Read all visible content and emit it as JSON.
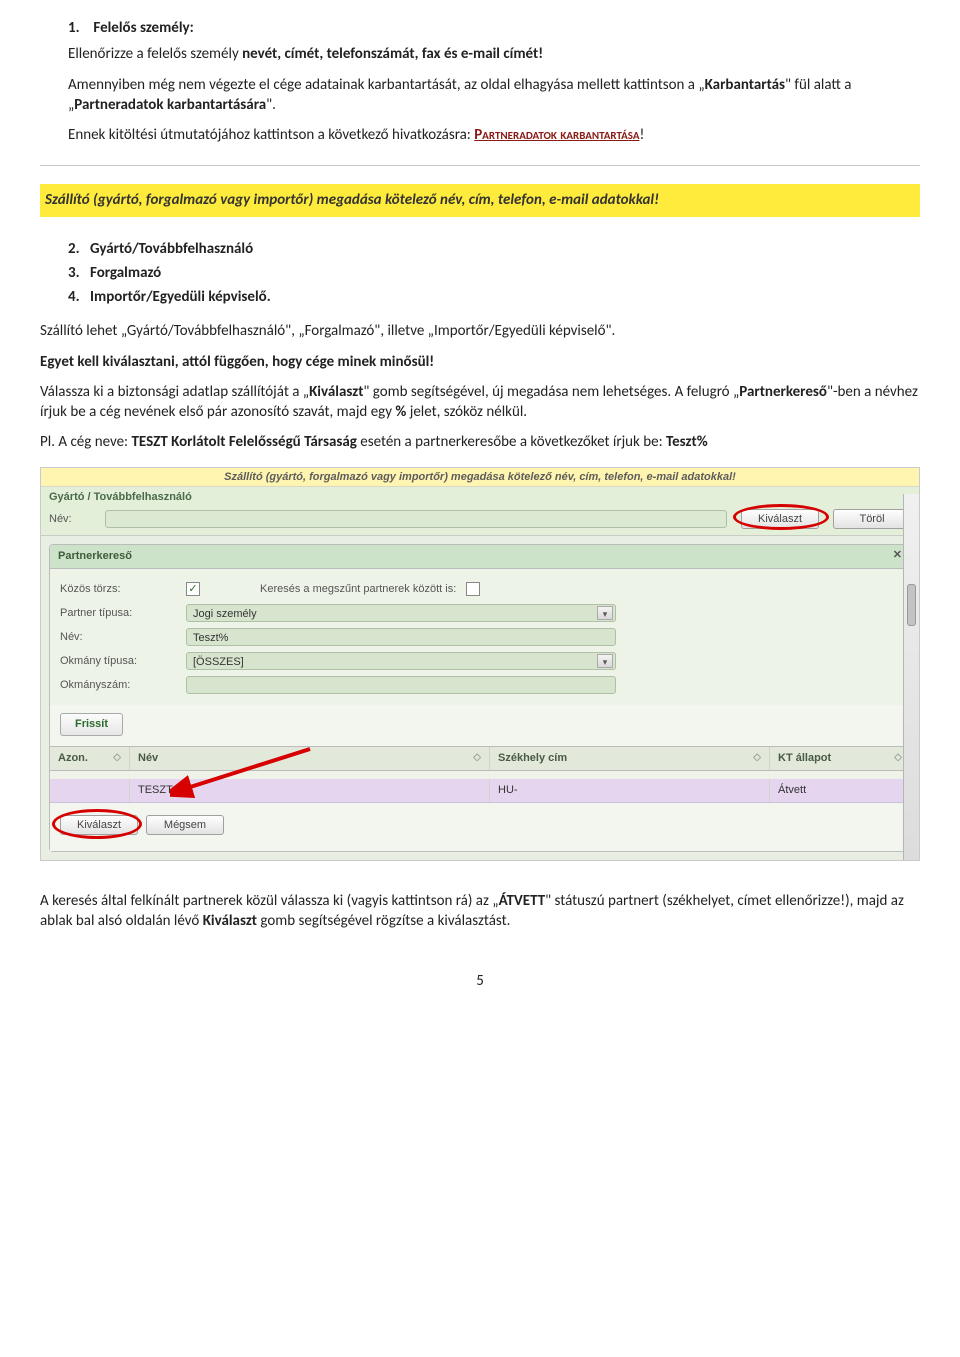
{
  "section1": {
    "num": "1.",
    "title": "Felelős személy:",
    "p1_a": "Ellenőrizze a felelős személy ",
    "p1_b": "nevét, címét, telefonszámát, fax és e-mail címét!",
    "p2_a": "Amennyiben még nem végezte el cége adatainak karbantartását, az oldal elhagyása mellett kattintson a „",
    "p2_b": "Karbantartás",
    "p2_c": "\" fül alatt a „",
    "p2_d": "Partneradatok karbantartására",
    "p2_e": "\".",
    "p3_a": "Ennek kitöltési útmutatójához kattintson a következő hivatkozásra: ",
    "link": "Partneradatok karbantartása",
    "p3_b": "!"
  },
  "yellow_msg": "Szállító (gyártó, forgalmazó vagy importőr) megadása kötelező név, cím, telefon, e-mail adatokkal!",
  "list2": {
    "i2n": "2.",
    "i2": "Gyártó/Továbbfelhasználó",
    "i3n": "3.",
    "i3": "Forgalmazó",
    "i4n": "4.",
    "i4": "Importőr/Egyedüli képviselő."
  },
  "body": {
    "p4": "Szállító lehet „Gyártó/Továbbfelhasználó\", „Forgalmazó\", illetve „Importőr/Egyedüli képviselő\".",
    "p5": "Egyet kell kiválasztani, attól függően, hogy cége minek minősül!",
    "p6_a": "Válassza ki a biztonsági adatlap szállítóját a „",
    "p6_b": "Kiválaszt",
    "p6_c": "\" gomb segítségével, új megadása nem lehetséges. A felugró „",
    "p6_d": "Partnerkereső",
    "p6_e": "\"-ben a névhez írjuk be a cég nevének első pár azonosító szavát, majd egy ",
    "p6_f": "%",
    "p6_g": " jelet, szóköz nélkül.",
    "p7_a": "Pl. A cég neve: ",
    "p7_b": "TESZT Korlátolt Felelősségű Társaság",
    "p7_c": " esetén a partnerkeresőbe a következőket írjuk be: ",
    "p7_d": "Teszt%"
  },
  "app": {
    "top_yellow": "Szállító (gyártó, forgalmazó vagy importőr) megadása kötelező név, cím, telefon, e-mail adatokkal!",
    "gy_label": "Gyártó / Továbbfelhasználó",
    "nev_label": "Név:",
    "btn_kivalaszt": "Kiválaszt",
    "btn_torol": "Töröl",
    "panel_title": "Partnerkereső",
    "close": "✕",
    "f1_label": "Közös törzs:",
    "f1_chk": "✓",
    "f1_right": "Keresés a megszűnt partnerek között is:",
    "f2_label": "Partner típusa:",
    "f2_val": "Jogi személy",
    "f3_label": "Név:",
    "f3_val": "Teszt%",
    "f4_label": "Okmány típusa:",
    "f4_val": "[ÖSSZES]",
    "f5_label": "Okmányszám:",
    "btn_refresh": "Frissít",
    "col_azon": "Azon.",
    "col_nev": "Név",
    "col_szek": "Székhely cím",
    "col_kt": "KT állapot",
    "row_nev": "TESZT",
    "row_szek": "HU-",
    "row_kt": "Átvett",
    "btn_kiv2": "Kiválaszt",
    "btn_megsem": "Mégsem"
  },
  "closing": {
    "p8_a": "A keresés által felkínált partnerek közül válassza ki (vagyis kattintson rá) az „",
    "p8_b": "ÁTVETT",
    "p8_c": "\" státuszú partnert (székhelyet, címet ellenőrizze!), majd az ablak bal alsó oldalán lévő ",
    "p8_d": "Kiválaszt",
    "p8_e": " gomb segítségével rögzítse a kiválasztást."
  },
  "page_num": "5"
}
